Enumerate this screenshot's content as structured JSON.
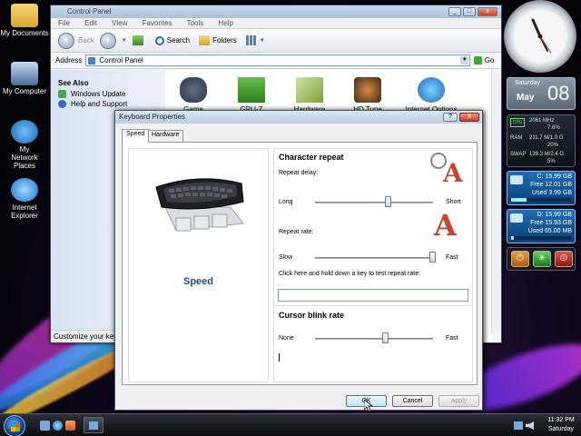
{
  "desktop": {
    "icons": [
      {
        "label": "My Documents"
      },
      {
        "label": "My Computer"
      },
      {
        "label": "My Network Places"
      },
      {
        "label": "Internet Explorer"
      }
    ]
  },
  "control_panel": {
    "title": "Control Panel",
    "menu": [
      "File",
      "Edit",
      "View",
      "Favorites",
      "Tools",
      "Help"
    ],
    "toolbar": {
      "back": "Back",
      "search": "Search",
      "folders": "Folders"
    },
    "address_label": "Address",
    "address_value": "Control Panel",
    "go_label": "Go",
    "see_also": {
      "heading": "See Also",
      "links": [
        "Windows Update",
        "Help and Support"
      ]
    },
    "items": [
      "Game Controllers",
      "GPU-Z",
      "Hardware",
      "HD Tune",
      "Internet Options"
    ],
    "status": "Customize your keyb"
  },
  "keyboard_properties": {
    "title": "Keyboard Properties",
    "help_glyph": "?",
    "close_glyph": "X",
    "tabs": [
      "Speed",
      "Hardware"
    ],
    "left_caption": "Speed",
    "character_repeat": {
      "heading": "Character repeat",
      "repeat_delay_label": "Repeat delay:",
      "delay_min": "Long",
      "delay_max": "Short",
      "delay_value": 0.62,
      "repeat_rate_label": "Repeat rate:",
      "rate_min": "Slow",
      "rate_max": "Fast",
      "rate_value": 1.0,
      "test_label": "Click here and hold down a key to test repeat rate:"
    },
    "cursor_blink": {
      "heading": "Cursor blink rate",
      "min": "None",
      "max": "Fast",
      "value": 0.6
    },
    "buttons": {
      "ok": "OK",
      "cancel": "Cancel",
      "apply": "Apply"
    }
  },
  "gadgets": {
    "calendar": {
      "weekday": "Saturday",
      "month": "May",
      "day": "08"
    },
    "cpu": {
      "label": "CPU",
      "freq": "2061 MHz",
      "load": "7.6%"
    },
    "ram": {
      "label": "RAM",
      "value": "211.7 M/1.0 G",
      "pct": "20%"
    },
    "swap": {
      "label": "SWAP",
      "value": "139.3 M/2.4 G",
      "pct": "5%"
    },
    "drive_c": {
      "letter": "C:",
      "size": "15.99 GB",
      "free": "Free 12.01 GB",
      "used": "Used 3.99 GB",
      "used_fraction": 0.25
    },
    "drive_d": {
      "letter": "D:",
      "size": "15.99 GB",
      "free": "Free 15.93 GB",
      "used": "Used 65.00 MB",
      "used_fraction": 0.04
    }
  },
  "taskbar": {
    "time": "11:32 PM",
    "day": "Saturday"
  },
  "colors": {
    "accent_blue": "#1f6fb7",
    "close_red": "#c5432a",
    "window_bg": "#f0f0f0"
  }
}
